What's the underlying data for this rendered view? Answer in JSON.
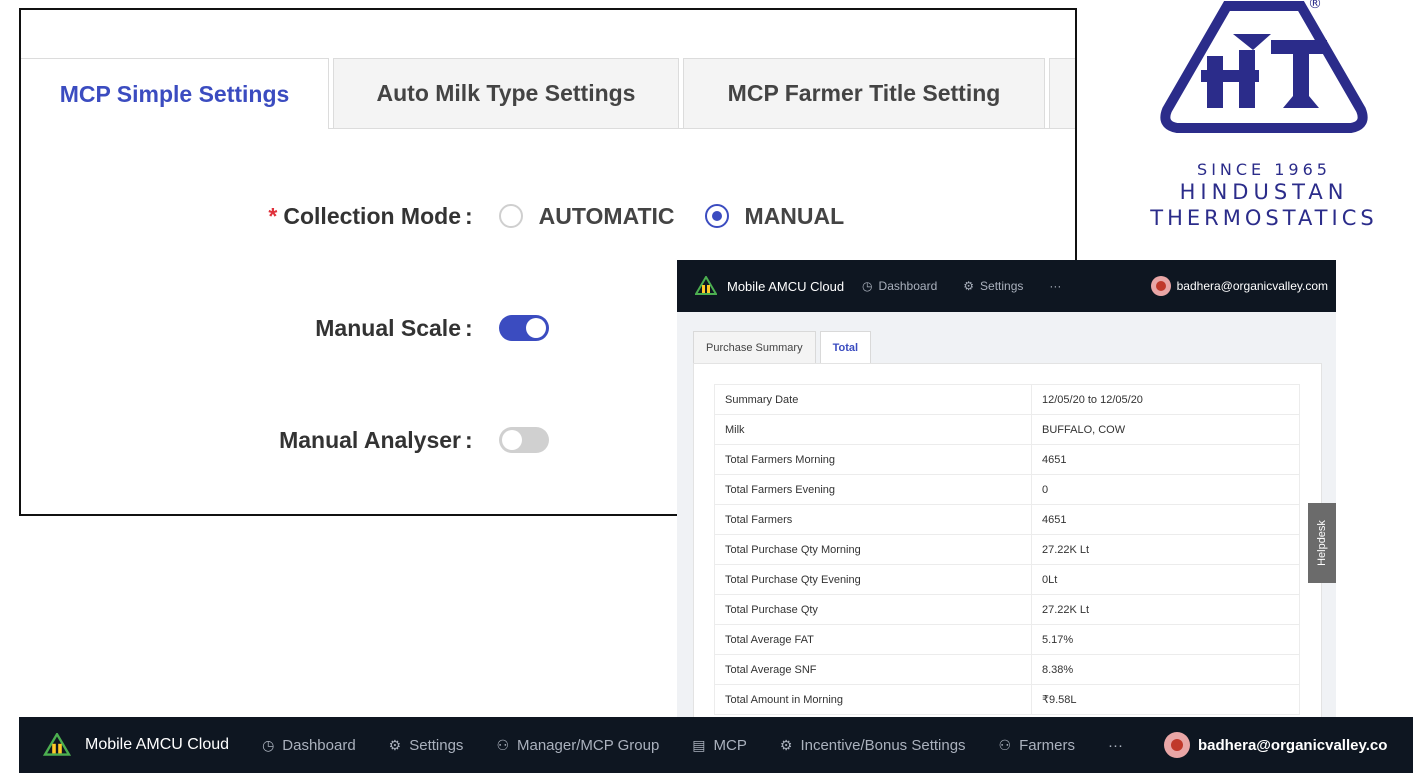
{
  "settings_panel": {
    "tabs": [
      {
        "label": "MCP Simple Settings"
      },
      {
        "label": "Auto Milk Type Settings"
      },
      {
        "label": "MCP Farmer Title Setting"
      }
    ],
    "collection_mode": {
      "required_mark": "*",
      "label": "Collection Mode",
      "options": [
        "AUTOMATIC",
        "MANUAL"
      ],
      "selected": "MANUAL"
    },
    "manual_scale": {
      "label": "Manual Scale",
      "enabled": true
    },
    "manual_analyser": {
      "label": "Manual Analyser",
      "enabled": false
    }
  },
  "logo": {
    "registered": "®",
    "since": "SINCE 1965",
    "line1": "HINDUSTAN",
    "line2": "THERMOSTATICS"
  },
  "inner_app": {
    "brand": "Mobile AMCU Cloud",
    "nav": [
      "Dashboard",
      "Settings",
      "···"
    ],
    "user": "badhera@organicvalley.com",
    "tabs": [
      "Purchase Summary",
      "Total"
    ],
    "active_tab": "Total",
    "summary_rows": [
      {
        "key": "Summary Date",
        "value": "12/05/20 to 12/05/20"
      },
      {
        "key": "Milk",
        "value": "BUFFALO, COW"
      },
      {
        "key": "Total Farmers Morning",
        "value": "4651"
      },
      {
        "key": "Total Farmers Evening",
        "value": "0"
      },
      {
        "key": "Total Farmers",
        "value": "4651"
      },
      {
        "key": "Total Purchase Qty Morning",
        "value": "27.22K Lt"
      },
      {
        "key": "Total Purchase Qty Evening",
        "value": "0Lt"
      },
      {
        "key": "Total Purchase Qty",
        "value": "27.22K Lt"
      },
      {
        "key": "Total Average FAT",
        "value": "5.17%"
      },
      {
        "key": "Total Average SNF",
        "value": "8.38%"
      },
      {
        "key": "Total Amount in Morning",
        "value": "₹9.58L"
      }
    ],
    "helpdesk": "Helpdesk"
  },
  "bottom_nav": {
    "brand": "Mobile AMCU Cloud",
    "items": [
      "Dashboard",
      "Settings",
      "Manager/MCP Group",
      "MCP",
      "Incentive/Bonus Settings",
      "Farmers",
      "···"
    ],
    "user": "badhera@organicvalley.co"
  },
  "colors": {
    "accent": "#3b4cc0",
    "nav_bg": "#0e1621",
    "logo_blue": "#2b2c8a"
  }
}
